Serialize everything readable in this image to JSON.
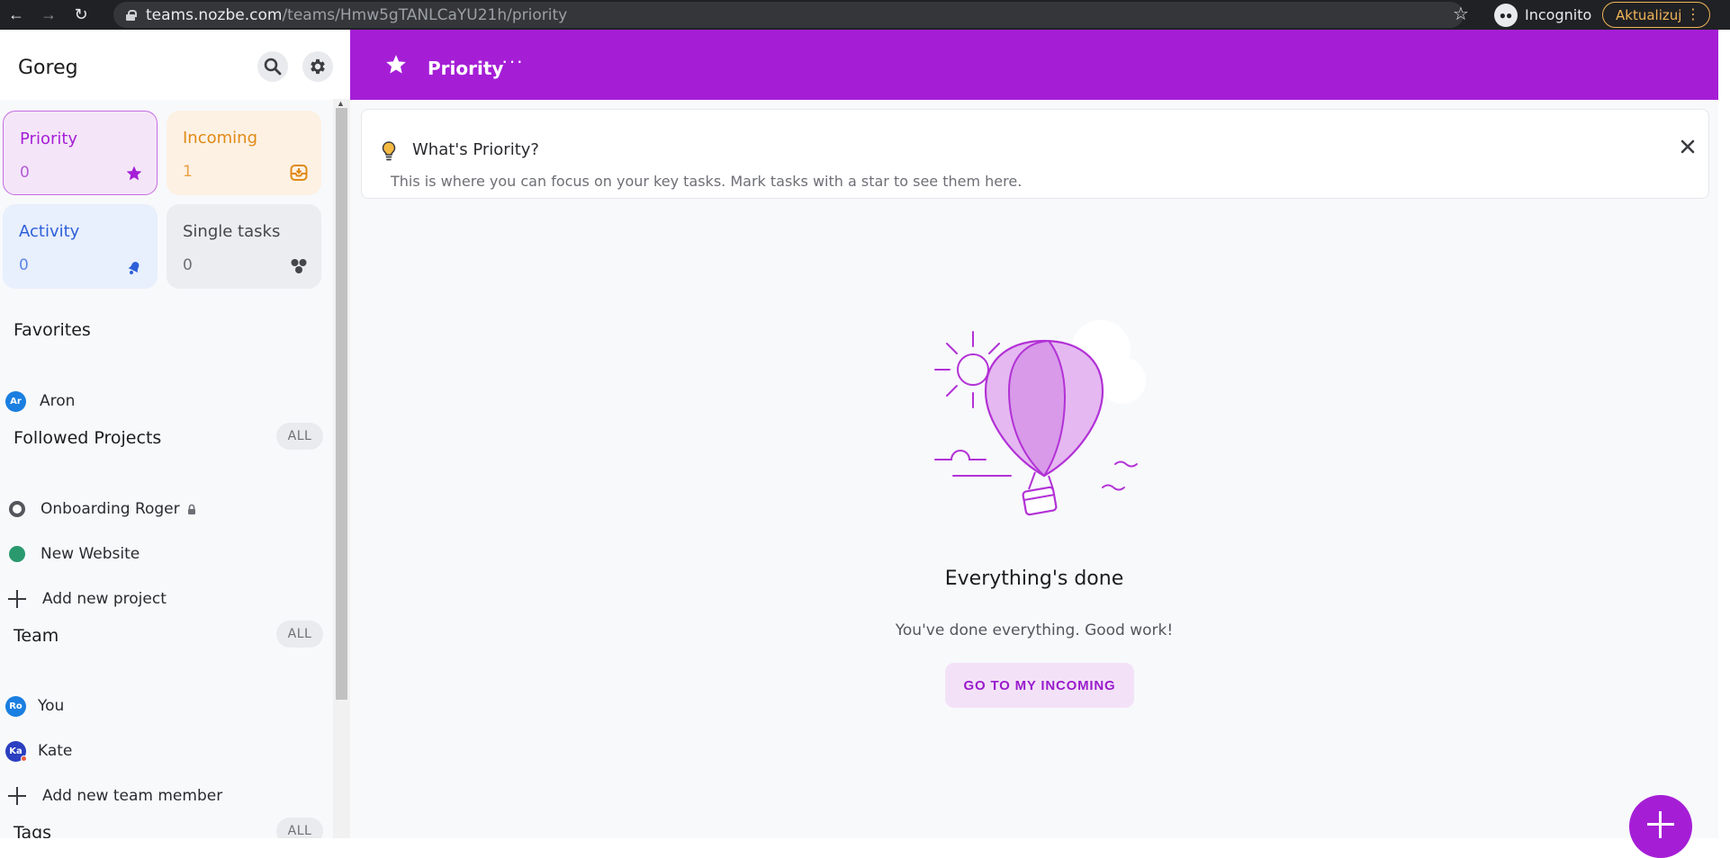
{
  "browser": {
    "url_host": "teams.nozbe.com",
    "url_path": "/teams/Hmw5gTANLCaYU21h/priority",
    "incognito_label": "Incognito",
    "update_label": "Aktualizuj"
  },
  "sidebar": {
    "workspace": "Goreg",
    "tiles": [
      {
        "label": "Priority",
        "count": "0",
        "icon": "star-icon",
        "color": "#a51ed6"
      },
      {
        "label": "Incoming",
        "count": "1",
        "icon": "inbox-icon",
        "color": "#e08a15"
      },
      {
        "label": "Activity",
        "count": "0",
        "icon": "bell-icon",
        "color": "#2d5fd8"
      },
      {
        "label": "Single tasks",
        "count": "0",
        "icon": "dots-icon",
        "color": "#45464c"
      }
    ],
    "favorites_title": "Favorites",
    "favorites": [
      {
        "initials": "Ar",
        "name": "Aron"
      }
    ],
    "followed_title": "Followed Projects",
    "followed_all": "ALL",
    "projects": [
      {
        "name": "Onboarding Roger",
        "locked": true
      },
      {
        "name": "New Website",
        "locked": false
      }
    ],
    "add_project": "Add new project",
    "team_title": "Team",
    "team_all": "ALL",
    "team": [
      {
        "initials": "Ro",
        "name": "You"
      },
      {
        "initials": "Ka",
        "name": "Kate"
      }
    ],
    "add_member": "Add new team member",
    "tags_title": "Tags",
    "tags_all": "ALL"
  },
  "header": {
    "title": "Priority",
    "more": "···",
    "accent": "#a51ed6"
  },
  "info": {
    "title": "What's Priority?",
    "text": "This is where you can focus on your key tasks. Mark tasks with a star to see them here."
  },
  "empty": {
    "title": "Everything's done",
    "subtitle": "You've done everything. Good work!",
    "button": "GO TO MY INCOMING"
  }
}
